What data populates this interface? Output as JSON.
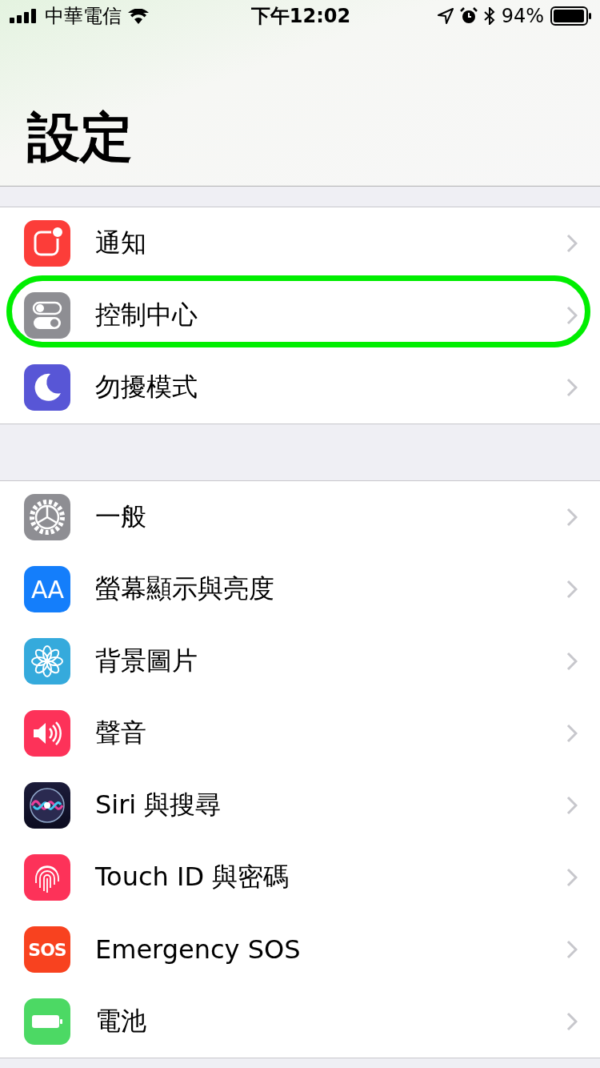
{
  "status_bar": {
    "carrier": "中華電信",
    "time": "下午12:02",
    "battery_percent": "94%"
  },
  "title": "設定",
  "groups": [
    {
      "items": [
        {
          "label": "通知",
          "kind": "notifications",
          "highlighted": false
        },
        {
          "label": "控制中心",
          "kind": "control",
          "highlighted": true
        },
        {
          "label": "勿擾模式",
          "kind": "moon",
          "highlighted": false
        }
      ]
    },
    {
      "items": [
        {
          "label": "一般",
          "kind": "gear",
          "highlighted": false
        },
        {
          "label": "螢幕顯示與亮度",
          "kind": "display",
          "icon_text": "AA",
          "highlighted": false
        },
        {
          "label": "背景圖片",
          "kind": "flower",
          "highlighted": false
        },
        {
          "label": "聲音",
          "kind": "speaker",
          "highlighted": false
        },
        {
          "label": "Siri 與搜尋",
          "kind": "siri",
          "highlighted": false
        },
        {
          "label": "Touch ID 與密碼",
          "kind": "fingerprint",
          "highlighted": false
        },
        {
          "label": "Emergency SOS",
          "kind": "sos",
          "icon_text": "SOS",
          "highlighted": false
        },
        {
          "label": "電池",
          "kind": "battery",
          "highlighted": false
        }
      ]
    }
  ]
}
